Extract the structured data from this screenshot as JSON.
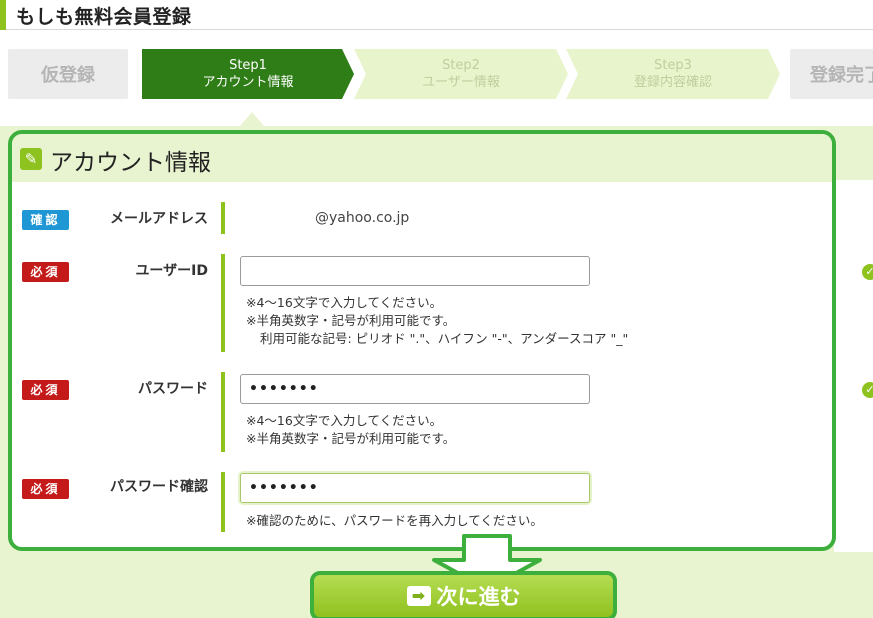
{
  "header": {
    "title": "もしも無料会員登録"
  },
  "steps": {
    "pre_registration": "仮登録",
    "step1": {
      "num": "Step1",
      "name": "アカウント情報"
    },
    "step2": {
      "num": "Step2",
      "name": "ユーザー情報"
    },
    "step3": {
      "num": "Step3",
      "name": "登録内容確認"
    },
    "complete": "登録完了"
  },
  "panel": {
    "title": "アカウント情報"
  },
  "rows": {
    "email": {
      "badge": "確認",
      "label": "メールアドレス",
      "value": "@yahoo.co.jp"
    },
    "user_id": {
      "badge": "必須",
      "label": "ユーザーID",
      "value": "",
      "hint1": "※4～16文字で入力してください。",
      "hint2": "※半角英数字・記号が利用可能です。",
      "hint3": "利用可能な記号: ピリオド \".\"、ハイフン \"-\"、アンダースコア \"_\""
    },
    "password": {
      "badge": "必須",
      "label": "パスワード",
      "value": "•••••••",
      "hint1": "※4～16文字で入力してください。",
      "hint2": "※半角英数字・記号が利用可能です。"
    },
    "password_confirm": {
      "badge": "必須",
      "label": "パスワード確認",
      "value": "•••••••",
      "hint1": "※確認のために、パスワードを再入力してください。"
    }
  },
  "next_button": {
    "label": "次に進む",
    "icon": "arrow-right-icon"
  },
  "colors": {
    "accent_green": "#8dc21f",
    "active_step": "#2e7d16",
    "required_red": "#c41a1a",
    "confirm_blue": "#1f97d4",
    "highlight_border": "#3caf3c"
  }
}
